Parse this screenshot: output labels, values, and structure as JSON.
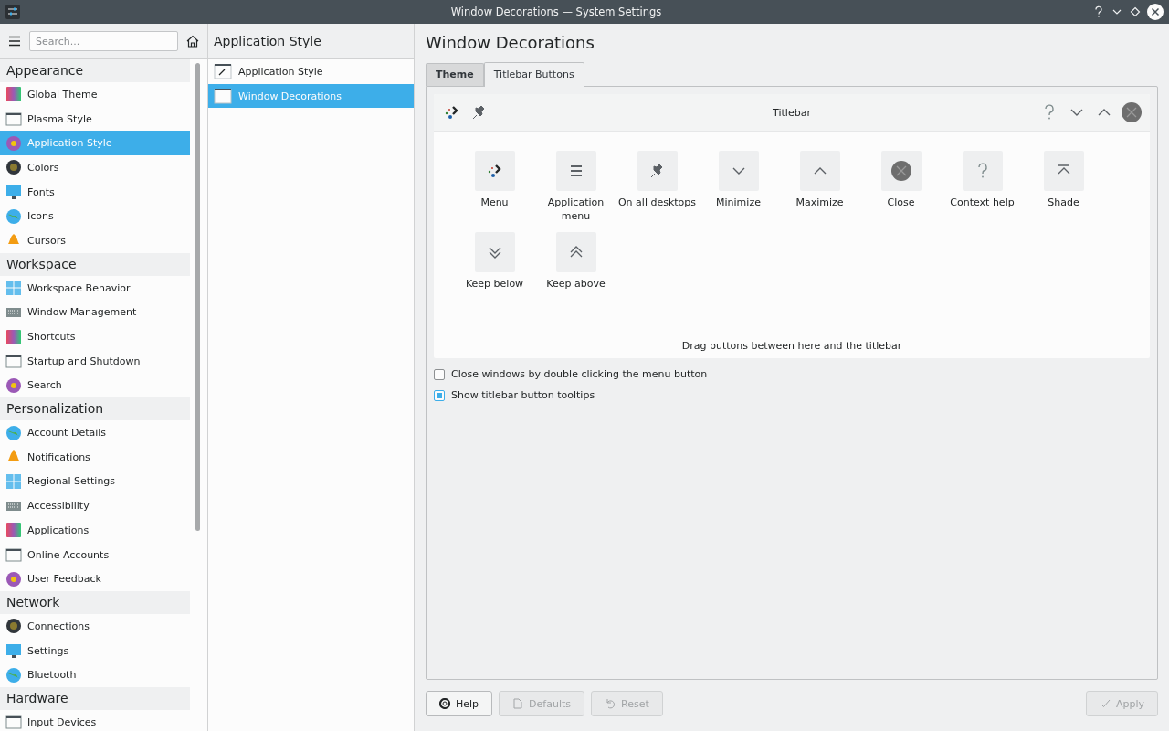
{
  "window": {
    "title": "Window Decorations — System Settings"
  },
  "search": {
    "placeholder": "Search..."
  },
  "sidebar": {
    "groups": [
      {
        "label": "Appearance",
        "items": [
          {
            "label": "Global Theme",
            "selected": false
          },
          {
            "label": "Plasma Style",
            "selected": false
          },
          {
            "label": "Application Style",
            "selected": true
          },
          {
            "label": "Colors",
            "selected": false
          },
          {
            "label": "Fonts",
            "selected": false
          },
          {
            "label": "Icons",
            "selected": false
          },
          {
            "label": "Cursors",
            "selected": false
          }
        ]
      },
      {
        "label": "Workspace",
        "items": [
          {
            "label": "Workspace Behavior",
            "selected": false
          },
          {
            "label": "Window Management",
            "selected": false
          },
          {
            "label": "Shortcuts",
            "selected": false
          },
          {
            "label": "Startup and Shutdown",
            "selected": false
          },
          {
            "label": "Search",
            "selected": false
          }
        ]
      },
      {
        "label": "Personalization",
        "items": [
          {
            "label": "Account Details",
            "selected": false
          },
          {
            "label": "Notifications",
            "selected": false
          },
          {
            "label": "Regional Settings",
            "selected": false
          },
          {
            "label": "Accessibility",
            "selected": false
          },
          {
            "label": "Applications",
            "selected": false
          },
          {
            "label": "Online Accounts",
            "selected": false
          },
          {
            "label": "User Feedback",
            "selected": false
          }
        ]
      },
      {
        "label": "Network",
        "items": [
          {
            "label": "Connections",
            "selected": false
          },
          {
            "label": "Settings",
            "selected": false
          },
          {
            "label": "Bluetooth",
            "selected": false
          }
        ]
      },
      {
        "label": "Hardware",
        "items": [
          {
            "label": "Input Devices",
            "selected": false
          }
        ]
      }
    ]
  },
  "subpanel": {
    "title": "Application Style",
    "items": [
      {
        "label": "Application Style",
        "selected": false
      },
      {
        "label": "Window Decorations",
        "selected": true
      }
    ]
  },
  "main": {
    "title": "Window Decorations",
    "tabs": [
      {
        "label": "Theme",
        "selected": false
      },
      {
        "label": "Titlebar Buttons",
        "selected": true
      }
    ],
    "titlebar_preview": {
      "title": "Titlebar",
      "left_buttons": [
        {
          "kind": "menu"
        },
        {
          "kind": "pin"
        }
      ],
      "right_buttons": [
        {
          "kind": "help"
        },
        {
          "kind": "minimize"
        },
        {
          "kind": "maximize"
        },
        {
          "kind": "close"
        }
      ]
    },
    "available_buttons": [
      {
        "kind": "menu",
        "label": "Menu"
      },
      {
        "kind": "appmenu",
        "label": "Application menu"
      },
      {
        "kind": "pin",
        "label": "On all desktops"
      },
      {
        "kind": "minimize",
        "label": "Minimize"
      },
      {
        "kind": "maximize",
        "label": "Maximize"
      },
      {
        "kind": "close",
        "label": "Close"
      },
      {
        "kind": "help",
        "label": "Context help"
      },
      {
        "kind": "shade",
        "label": "Shade"
      },
      {
        "kind": "below",
        "label": "Keep below"
      },
      {
        "kind": "above",
        "label": "Keep above"
      }
    ],
    "hint": "Drag buttons between here and the titlebar",
    "options": [
      {
        "label": "Close windows by double clicking the menu button",
        "checked": false
      },
      {
        "label": "Show titlebar button tooltips",
        "checked": true
      }
    ]
  },
  "footer": {
    "left": [
      {
        "kind": "help",
        "label": "Help",
        "disabled": false
      },
      {
        "kind": "defaults",
        "label": "Defaults",
        "disabled": true
      },
      {
        "kind": "reset",
        "label": "Reset",
        "disabled": true
      }
    ],
    "right": [
      {
        "kind": "apply",
        "label": "Apply",
        "disabled": true
      }
    ]
  }
}
